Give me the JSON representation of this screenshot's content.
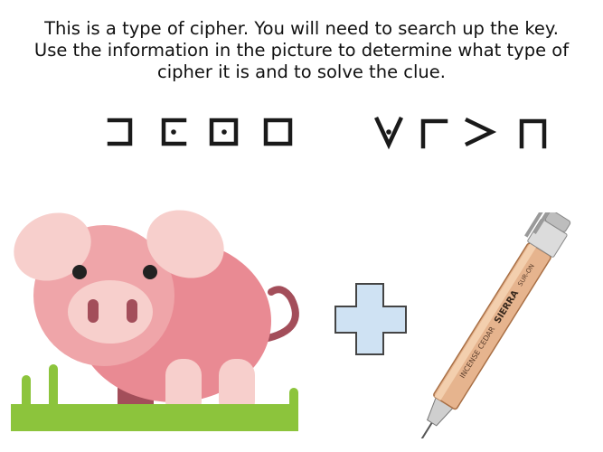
{
  "instructions": {
    "line1": "This is a type of cipher. You will need to search up the key.",
    "line2": "Use the information in the picture to determine what type of",
    "line3": "cipher it is and to solve the clue."
  },
  "cipher": {
    "word1": [
      "pigpen-right-bracket-icon",
      "pigpen-left-bracket-dot-icon",
      "pigpen-box-dot-icon",
      "pigpen-box-icon"
    ],
    "word2": [
      "pigpen-v-dot-icon",
      "pigpen-corner-icon",
      "pigpen-greater-than-icon",
      "pigpen-n-icon"
    ],
    "color": "#1a1a1a"
  },
  "pen": {
    "text1": "INCENSE CEDAR",
    "text2": "SIERRA",
    "text3": "SUR-ON"
  },
  "colors": {
    "pig_body": "#ee8e95",
    "pig_light": "#f7c8c6",
    "grass": "#8cc43c",
    "plus": "#cfe2f3"
  }
}
